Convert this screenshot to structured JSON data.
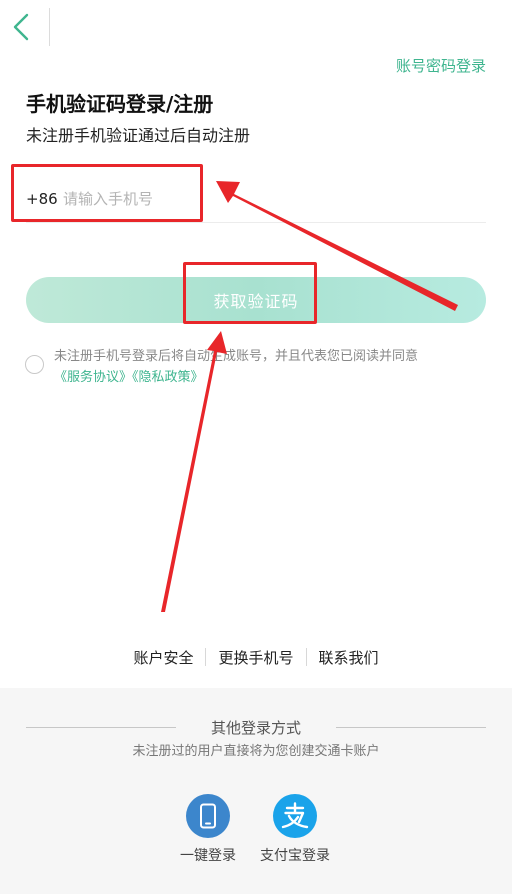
{
  "header": {
    "alt_login_label": "账号密码登录"
  },
  "page": {
    "title": "手机验证码登录/注册",
    "subtitle": "未注册手机验证通过后自动注册"
  },
  "phone": {
    "country_code": "+86",
    "placeholder": "请输入手机号",
    "value": ""
  },
  "get_code_label": "获取验证码",
  "agreement": {
    "prefix": "未注册手机号登录后将自动生成账号，并且代表您已阅读并同意",
    "service_label": "《服务协议》",
    "privacy_label": "《隐私政策》",
    "checked": false
  },
  "footer_links": [
    "账户安全",
    "更换手机号",
    "联系我们"
  ],
  "other_login": {
    "title": "其他登录方式",
    "subtitle": "未注册过的用户直接将为您创建交通卡账户",
    "options": [
      {
        "label": "一键登录",
        "icon": "mobile-phone-icon"
      },
      {
        "label": "支付宝登录",
        "icon": "alipay-icon"
      }
    ]
  },
  "colors": {
    "accent": "#3fb58f",
    "annotation": "#e8262a",
    "phone_icon_bg": "#3c86cc",
    "alipay_icon_bg": "#1aa3ea"
  }
}
